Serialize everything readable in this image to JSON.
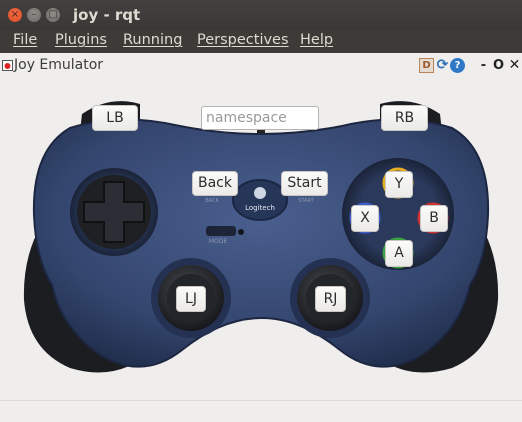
{
  "window": {
    "title": "joy - rqt"
  },
  "window_buttons": [
    "×",
    "–",
    "□"
  ],
  "menu": [
    "File",
    "Plugins",
    "Running",
    "Perspectives",
    "Help"
  ],
  "dock": {
    "title": "Joy Emulator",
    "help_glyph": "?",
    "d_glyph": "D",
    "controls": [
      "-",
      "O",
      "✕"
    ]
  },
  "namespace": {
    "placeholder": "namespace",
    "value": ""
  },
  "buttons": {
    "lb": "LB",
    "rb": "RB",
    "back": "Back",
    "start": "Start",
    "y": "Y",
    "x": "X",
    "b": "B",
    "a": "A",
    "lj": "LJ",
    "rj": "RJ"
  },
  "controller": {
    "brand": "Logitech",
    "mode_label": "MODE",
    "back_label": "BACK",
    "start_label": "START"
  },
  "colors": {
    "body": "#34466e",
    "grip": "#1b1d21",
    "y_ring": "#e8b020",
    "x_ring": "#3a5ed0",
    "b_ring": "#d03030",
    "a_ring": "#3aa040"
  }
}
